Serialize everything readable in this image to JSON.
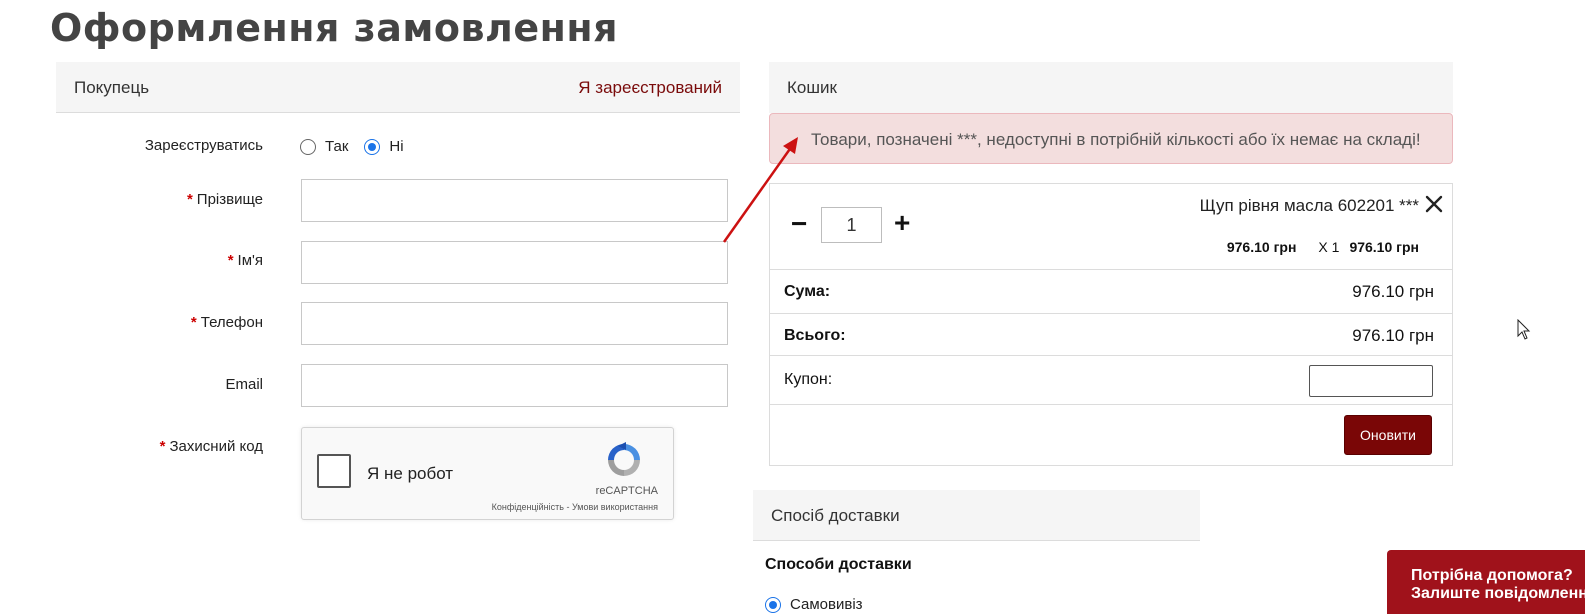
{
  "page": {
    "title": "Оформлення замовлення"
  },
  "buyer": {
    "title": "Покупець",
    "login_link": "Я зареєстрований",
    "register_label": "Зареєструватись",
    "register_options": [
      {
        "label": "Так",
        "checked": false
      },
      {
        "label": "Ні",
        "checked": true
      }
    ],
    "required_mark": "*",
    "fields": {
      "surname": {
        "label": "Прізвище",
        "required": true,
        "value": ""
      },
      "name": {
        "label": "Ім'я",
        "required": true,
        "value": ""
      },
      "phone": {
        "label": "Телефон",
        "required": true,
        "value": ""
      },
      "email": {
        "label": "Email",
        "required": false,
        "value": ""
      }
    },
    "captcha_label": "Захисний код",
    "recaptcha": {
      "checkbox_label": "Я не робот",
      "brand": "reCAPTCHA",
      "terms": "Конфіденційність - Умови використання"
    }
  },
  "cart": {
    "title": "Кошик",
    "alert": "Товари, позначені ***, недоступні в потрібній кількості або їх немає на складі!",
    "item": {
      "name": "Щуп рівня масла 602201 ***",
      "quantity": "1",
      "unit_price": "976.10 грн",
      "multiplier": "X 1",
      "line_total": "976.10 грн",
      "minus": "−",
      "plus": "+"
    },
    "subtotal_label": "Сума:",
    "subtotal_value": "976.10 грн",
    "total_label": "Всього:",
    "total_value": "976.10 грн",
    "coupon_label": "Купон:",
    "coupon_value": "",
    "update_button": "Оновити"
  },
  "delivery": {
    "title": "Спосіб доставки",
    "subtitle": "Способи доставки",
    "options": [
      {
        "label": "Самовивіз",
        "checked": true
      }
    ]
  },
  "help": {
    "line1": "Потрібна допомога?",
    "line2": "Залиште повідомлення"
  },
  "colors": {
    "brand": "#7a0606",
    "alert_bg": "#f3dede",
    "help_bg": "#a0121b",
    "annotation_arrow": "#cc1111"
  }
}
